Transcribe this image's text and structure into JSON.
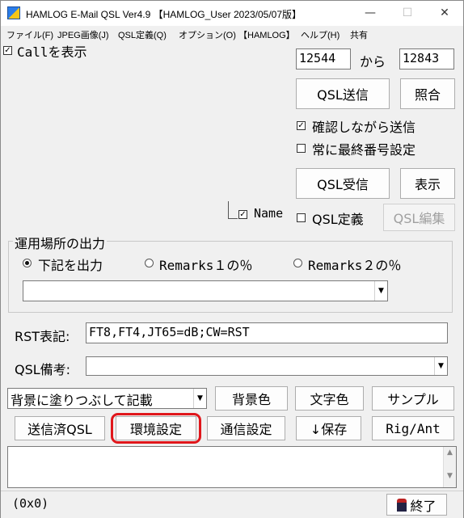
{
  "window": {
    "title": "HAMLOG E-Mail QSL Ver4.9 【HAMLOG_User 2023/05/07版】",
    "minimize": "—",
    "maximize": "☐",
    "close": "✕"
  },
  "menu": [
    "ファイル(F)",
    "JPEG画像(J)",
    "QSL定義(Q)",
    "オプション(O)",
    "【HAMLOG】",
    "ヘルプ(H)",
    "共有"
  ],
  "call_display": {
    "label": "Callを表示",
    "checked": true
  },
  "range": {
    "from": "12544",
    "sep": "から",
    "to": "12843"
  },
  "buttons": {
    "qsl_send": "QSL送信",
    "match": "照合",
    "qsl_receive": "QSL受信",
    "display": "表示",
    "qsl_edit": "QSL編集",
    "bg_color": "背景色",
    "text_color": "文字色",
    "sample": "サンプル",
    "sent_qsl": "送信済QSL",
    "env_settings": "環境設定",
    "comm_settings": "通信設定",
    "save": "↓保存",
    "rig_ant": "Rig/Ant",
    "exit": "終了"
  },
  "options": {
    "confirm_send": {
      "label": "確認しながら送信",
      "checked": true
    },
    "always_last": {
      "label": "常に最終番号設定",
      "checked": false
    },
    "name": {
      "label": "Name",
      "checked": true
    },
    "qsl_def": {
      "label": "QSL定義",
      "checked": false
    }
  },
  "location": {
    "title": "運用場所の出力",
    "radio1": "下記を出力",
    "radio2": "Remarks１の％",
    "radio3": "Remarks２の％",
    "selected": 1,
    "combo_value": ""
  },
  "rst": {
    "label": "RST表記:",
    "value": "FT8,FT4,JT65=dB;CW=RST"
  },
  "qsl_note": {
    "label": "QSL備考:",
    "value": ""
  },
  "bg_mode": {
    "value": "背景に塗りつぶして記載"
  },
  "status": {
    "coords": "(0x0)"
  },
  "colors": {
    "highlight": "#e0161b"
  }
}
